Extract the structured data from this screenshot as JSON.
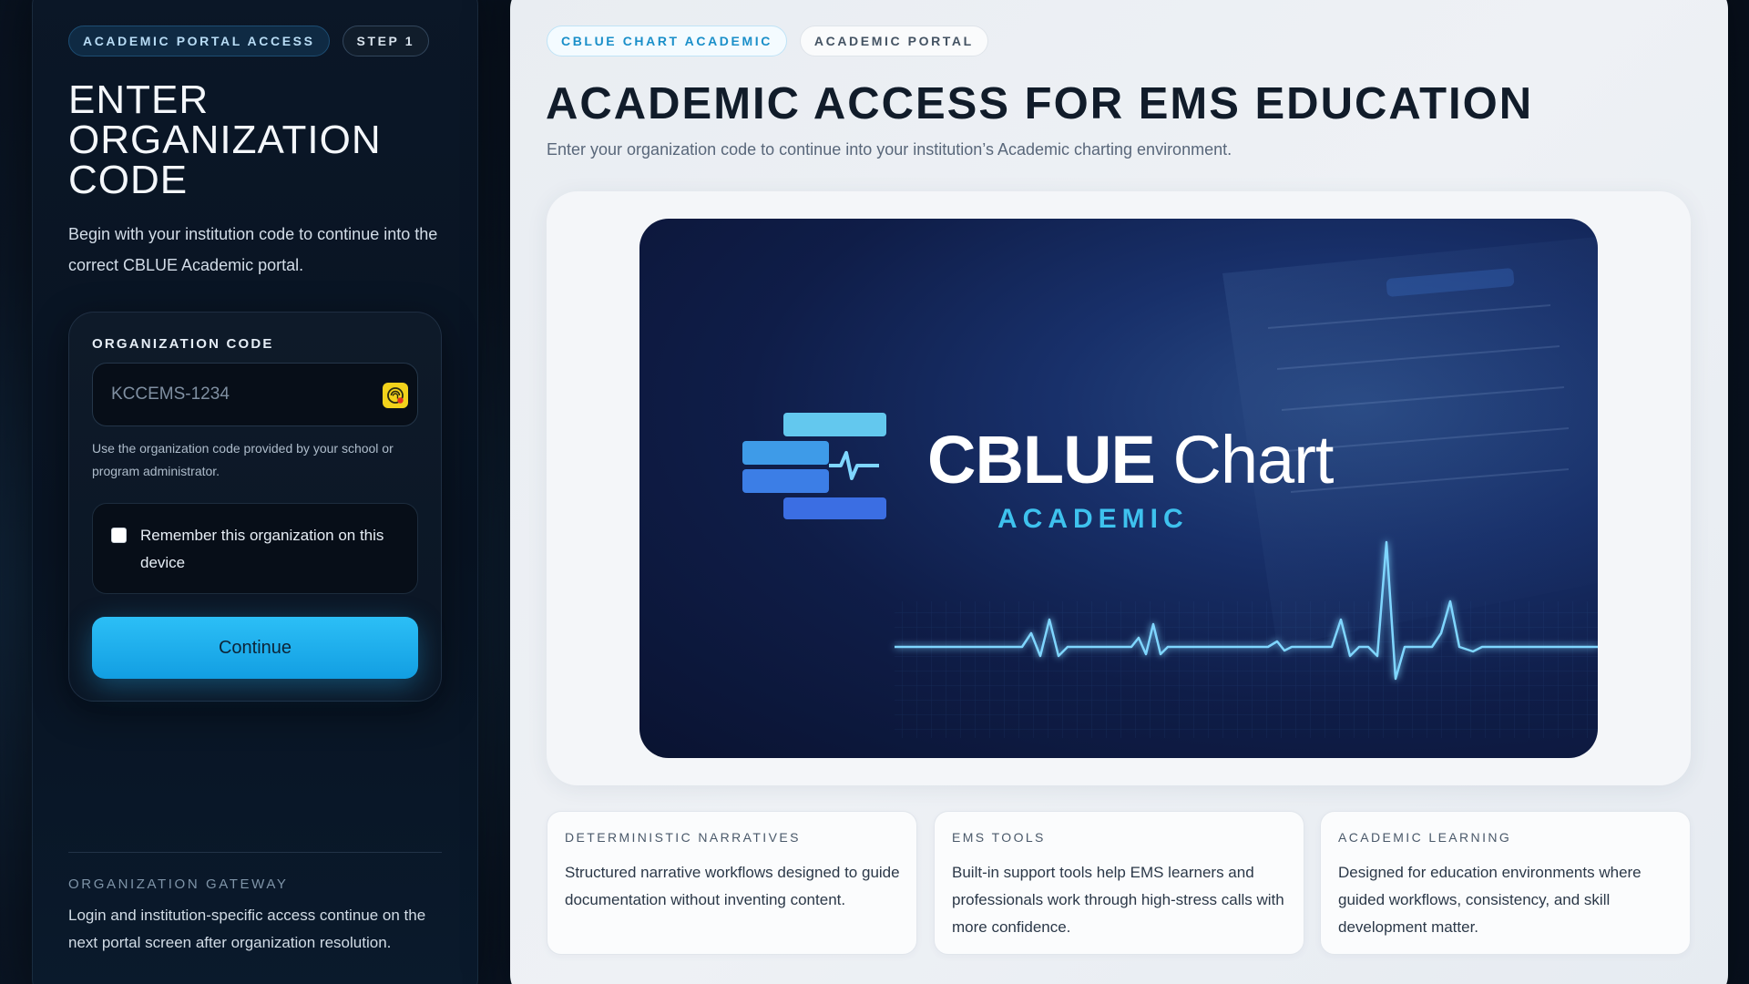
{
  "left": {
    "pill_primary": "ACADEMIC PORTAL ACCESS",
    "pill_step": "STEP 1",
    "title": "ENTER ORGANIZATION CODE",
    "description": "Begin with your institution code to continue into the correct CBLUE Academic portal.",
    "form": {
      "label": "ORGANIZATION CODE",
      "input_value": "",
      "input_placeholder": "KCCEMS-1234",
      "helper": "Use the organization code provided by your school or program administrator.",
      "remember_label": "Remember this organization on this device",
      "remember_checked": false,
      "continue_label": "Continue"
    },
    "gateway": {
      "title": "ORGANIZATION GATEWAY",
      "description": "Login and institution-specific access continue on the next portal screen after organization resolution."
    }
  },
  "right": {
    "pill_primary": "CBLUE CHART ACADEMIC",
    "pill_secondary": "ACADEMIC PORTAL",
    "title": "ACADEMIC ACCESS FOR EMS EDUCATION",
    "subtitle": "Enter your organization code to continue into your institution’s Academic charting environment.",
    "hero": {
      "brand_bold": "CBLUE",
      "brand_light": " Chart",
      "brand_sub": "ACADEMIC"
    },
    "cards": [
      {
        "title": "DETERMINISTIC NARRATIVES",
        "text": "Structured narrative workflows designed to guide documentation without inventing content."
      },
      {
        "title": "EMS TOOLS",
        "text": "Built-in support tools help EMS learners and professionals work through high-stress calls with more confidence."
      },
      {
        "title": "ACADEMIC LEARNING",
        "text": "Designed for education environments where guided workflows, consistency, and skill development matter."
      }
    ]
  },
  "colors": {
    "accent": "#1fb0ee",
    "panel_dark": "#0b1727",
    "panel_light": "#eceff3",
    "brand_cyan": "#3ec2ee"
  },
  "icons": {
    "input_icon": "password-manager-icon",
    "logo": "cblue-logo-mark"
  }
}
